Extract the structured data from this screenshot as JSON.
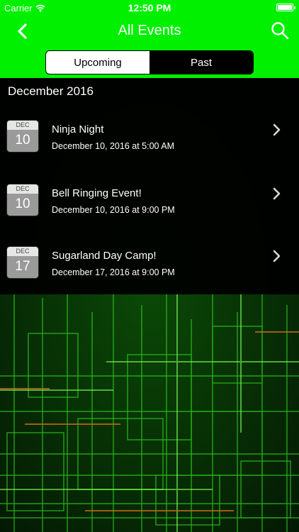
{
  "status_bar": {
    "carrier": "Carrier",
    "time": "12:50 PM"
  },
  "nav": {
    "title": "All Events",
    "back_icon": "chevron-left-icon",
    "search_icon": "search-icon"
  },
  "segments": {
    "upcoming": "Upcoming",
    "past": "Past",
    "selected": "Upcoming"
  },
  "colors": {
    "accent": "#00f000",
    "list_bg": "#000000"
  },
  "events_section": {
    "header": "December 2016",
    "items": [
      {
        "month": "DEC",
        "day": "10",
        "name": "Ninja Night",
        "when": "December 10, 2016 at 5:00 AM"
      },
      {
        "month": "DEC",
        "day": "10",
        "name": "Bell Ringing Event!",
        "when": "December 10, 2016 at 9:00 PM"
      },
      {
        "month": "DEC",
        "day": "17",
        "name": "Sugarland Day Camp!",
        "when": "December 17, 2016 at 9:00 PM"
      }
    ]
  }
}
